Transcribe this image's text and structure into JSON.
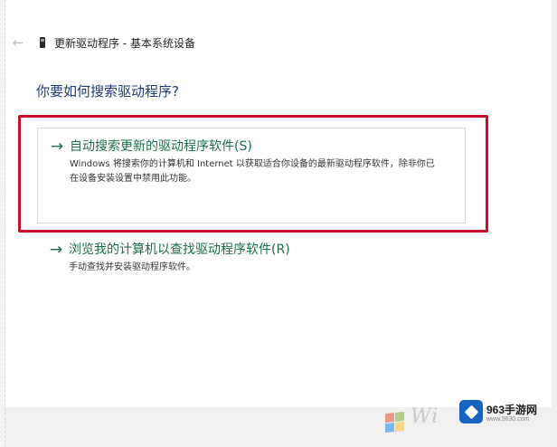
{
  "window": {
    "back_icon": "back-arrow-icon",
    "device_icon": "device-icon",
    "title": "更新驱动程序 - 基本系统设备"
  },
  "question": "你要如何搜索驱动程序?",
  "options": [
    {
      "arrow": "→",
      "title": "自动搜索更新的驱动程序软件(S)",
      "description": "Windows 将搜索你的计算机和 Internet 以获取适合你设备的最新驱动程序软件，除非你已在设备安装设置中禁用此功能。"
    },
    {
      "arrow": "→",
      "title": "浏览我的计算机以查找驱动程序软件(R)",
      "description": "手动查找并安装驱动程序软件。"
    }
  ],
  "highlight_color": "#c8102e",
  "link_color": "#1b6e4a",
  "watermark": {
    "text": "Wi",
    "site_name": "963手游网",
    "site_url": "www.9630.com",
    "logo_color": "#1565c0"
  }
}
